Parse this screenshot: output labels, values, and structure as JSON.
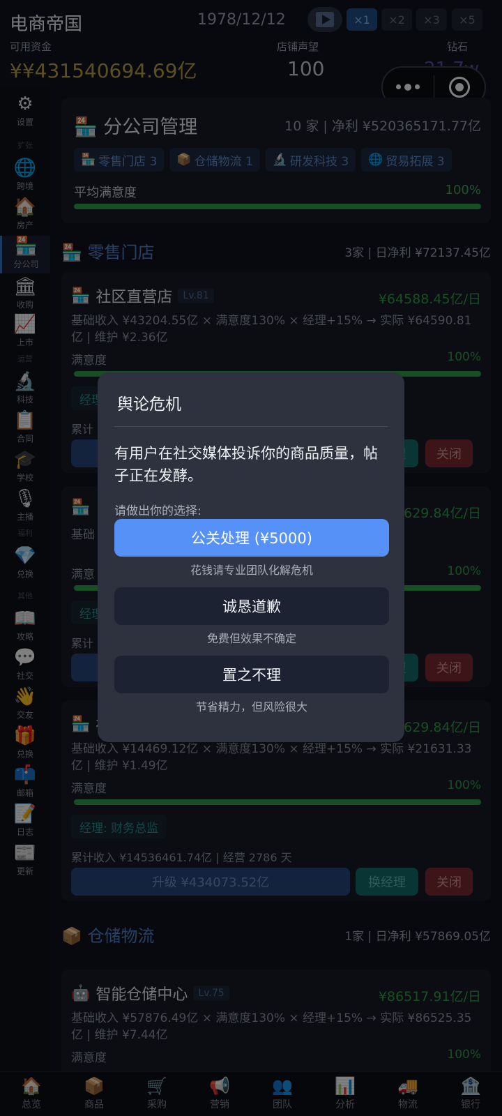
{
  "header": {
    "game_title": "电商帝国",
    "date": "1978/12/12",
    "speeds": [
      "×1",
      "×2",
      "×3",
      "×5"
    ],
    "active_speed": "×1",
    "funds_label": "可用资金",
    "funds_value": "¥¥431540694.69亿",
    "reputation_label": "店铺声望",
    "reputation_value": "100",
    "diamond_label": "钻石",
    "diamond_value": "21.7w"
  },
  "sidebar": {
    "items": [
      {
        "icon": "gear-icon",
        "glyph": "⚙",
        "label": "设置"
      },
      {
        "group": "扩张"
      },
      {
        "icon": "globe-icon",
        "glyph": "🌐",
        "label": "跨境"
      },
      {
        "icon": "house-icon",
        "glyph": "🏠",
        "label": "房产"
      },
      {
        "icon": "store-24-icon",
        "glyph": "🏪",
        "label": "分公司",
        "active": true
      },
      {
        "icon": "bank-building-icon",
        "glyph": "🏛",
        "label": "收购"
      },
      {
        "icon": "trend-chart-icon",
        "glyph": "📈",
        "label": "上市"
      },
      {
        "group": "运营"
      },
      {
        "icon": "microscope-icon",
        "glyph": "🔬",
        "label": "科技"
      },
      {
        "icon": "clipboard-icon",
        "glyph": "📋",
        "label": "合同"
      },
      {
        "icon": "graduation-cap-icon",
        "glyph": "🎓",
        "label": "学校"
      },
      {
        "icon": "microphone-icon",
        "glyph": "🎙",
        "label": "主播"
      },
      {
        "group": "福利"
      },
      {
        "icon": "diamond-icon",
        "glyph": "💎",
        "label": "兑换"
      },
      {
        "group": "其他"
      },
      {
        "icon": "book-icon",
        "glyph": "📖",
        "label": "攻略"
      },
      {
        "icon": "speech-bubble-icon",
        "glyph": "💬",
        "label": "社交"
      },
      {
        "icon": "wave-hand-icon",
        "glyph": "👋",
        "label": "交友"
      },
      {
        "icon": "gift-icon",
        "glyph": "🎁",
        "label": "兑换"
      },
      {
        "icon": "mailbox-icon",
        "glyph": "📫",
        "label": "邮箱"
      },
      {
        "icon": "memo-icon",
        "glyph": "📝",
        "label": "日志"
      },
      {
        "icon": "newspaper-icon",
        "glyph": "📰",
        "label": "更新"
      }
    ]
  },
  "summary": {
    "icon": "store-24-icon",
    "title": "分公司管理",
    "stats": "10 家 | 净利 ¥520365171.77亿",
    "tags": [
      {
        "glyph": "🏪",
        "label": "零售门店 3"
      },
      {
        "glyph": "📦",
        "label": "仓储物流 1"
      },
      {
        "glyph": "🔬",
        "label": "研发科技 3"
      },
      {
        "glyph": "🌐",
        "label": "贸易拓展 3"
      }
    ],
    "satisfaction_label": "平均满意度",
    "satisfaction_value": "100%",
    "satisfaction_fraction": 1.0
  },
  "retail_section": {
    "glyph": "🏪",
    "name": "零售门店",
    "stats": "3家 | 日净利 ¥72137.45亿"
  },
  "stores": [
    {
      "glyph": "🏪",
      "name": "社区直营店",
      "level": "Lv.81",
      "income": "¥64588.45亿/日",
      "formula": "基础收入 ¥43204.55亿 × 满意度130% × 经理+15% → 实际 ¥64590.81亿 | 维护 ¥2.36亿",
      "sat_label": "满意度",
      "sat_value": "100%",
      "sat_fraction": 1.0,
      "manager": "经理",
      "cumulative": "累计",
      "upgrade": "",
      "change_mgr": "换经理",
      "close": "关闭"
    },
    {
      "glyph": "🏪",
      "name": "",
      "level": "",
      "income": "629.84亿/日",
      "formula": "基础 ¥21631.33亿 | 维护",
      "sat_label": "满意",
      "sat_value": "100%",
      "sat_fraction": 1.0,
      "manager": "经理",
      "cumulative": "累计",
      "upgrade": "",
      "change_mgr": "换经理",
      "close": "关闭"
    },
    {
      "glyph": "🏪",
      "name": "社区直营店",
      "level": "",
      "income": "¥21629.84亿/日",
      "formula": "基础收入 ¥14469.12亿 × 满意度130% × 经理+15% → 实际 ¥21631.33亿 | 维护 ¥1.49亿",
      "sat_label": "满意度",
      "sat_value": "100%",
      "sat_fraction": 1.0,
      "manager": "经理: 财务总监",
      "cumulative": "累计收入 ¥14536461.74亿 | 经营 2786 天",
      "upgrade": "升级 ¥434073.52亿",
      "change_mgr": "换经理",
      "close": "关闭"
    }
  ],
  "logistics_section": {
    "glyph": "📦",
    "name": "仓储物流",
    "stats": "1家 | 日净利 ¥57869.05亿"
  },
  "logistics_store": {
    "glyph": "🤖",
    "name": "智能仓储中心",
    "level": "Lv.75",
    "income": "¥86517.91亿/日",
    "formula": "基础收入 ¥57876.49亿 × 满意度130% × 经理+15% → 实际 ¥86525.35亿 | 维护 ¥7.44亿",
    "sat_label": "满意度",
    "sat_value": "100%"
  },
  "bottom_nav": [
    {
      "icon": "house-icon",
      "glyph": "🏠",
      "label": "总览"
    },
    {
      "icon": "package-icon",
      "glyph": "📦",
      "label": "商品"
    },
    {
      "icon": "cart-icon",
      "glyph": "🛒",
      "label": "采购"
    },
    {
      "icon": "megaphone-icon",
      "glyph": "📢",
      "label": "营销"
    },
    {
      "icon": "team-icon",
      "glyph": "👥",
      "label": "团队"
    },
    {
      "icon": "bar-chart-icon",
      "glyph": "📊",
      "label": "分析"
    },
    {
      "icon": "truck-icon",
      "glyph": "🚚",
      "label": "物流"
    },
    {
      "icon": "bank-icon",
      "glyph": "🏦",
      "label": "银行"
    }
  ],
  "modal": {
    "title": "舆论危机",
    "description": "有用户在社交媒体投诉你的商品质量，帖子正在发酵。",
    "prompt": "请做出你的选择:",
    "options": [
      {
        "label": "公关处理 (¥5000)",
        "hint": "花钱请专业团队化解危机",
        "primary": true
      },
      {
        "label": "诚恳道歉",
        "hint": "免费但效果不确定",
        "primary": false
      },
      {
        "label": "置之不理",
        "hint": "节省精力，但风险很大",
        "primary": false
      }
    ]
  },
  "colors": {
    "primary_button": "#5591f6",
    "income_green": "#2f9e4a",
    "funds_gold": "#b9a040",
    "close_red": "#7a2b30"
  }
}
